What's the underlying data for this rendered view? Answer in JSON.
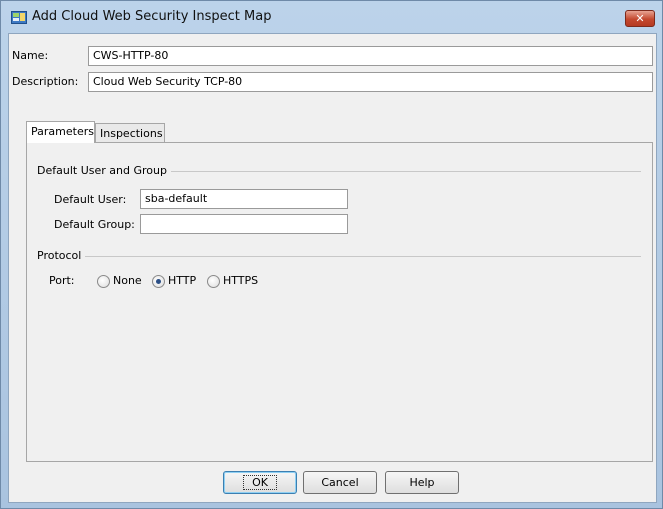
{
  "window": {
    "title": "Add Cloud Web Security Inspect Map",
    "close_label": "✕",
    "icon": "map-app-icon"
  },
  "form": {
    "name_label": "Name:",
    "name_value": "CWS-HTTP-80",
    "description_label": "Description:",
    "description_value": "Cloud Web Security TCP-80"
  },
  "tabs": [
    {
      "label": "Parameters",
      "active": true
    },
    {
      "label": "Inspections",
      "active": false
    }
  ],
  "parameters": {
    "user_group": {
      "title": "Default User and Group",
      "default_user_label": "Default User:",
      "default_user_value": "sba-default",
      "default_group_label": "Default Group:",
      "default_group_value": ""
    },
    "protocol": {
      "title": "Protocol",
      "port_label": "Port:",
      "options": [
        {
          "label": "None",
          "checked": false
        },
        {
          "label": "HTTP",
          "checked": true
        },
        {
          "label": "HTTPS",
          "checked": false
        }
      ]
    }
  },
  "buttons": {
    "ok": "OK",
    "cancel": "Cancel",
    "help": "Help"
  }
}
